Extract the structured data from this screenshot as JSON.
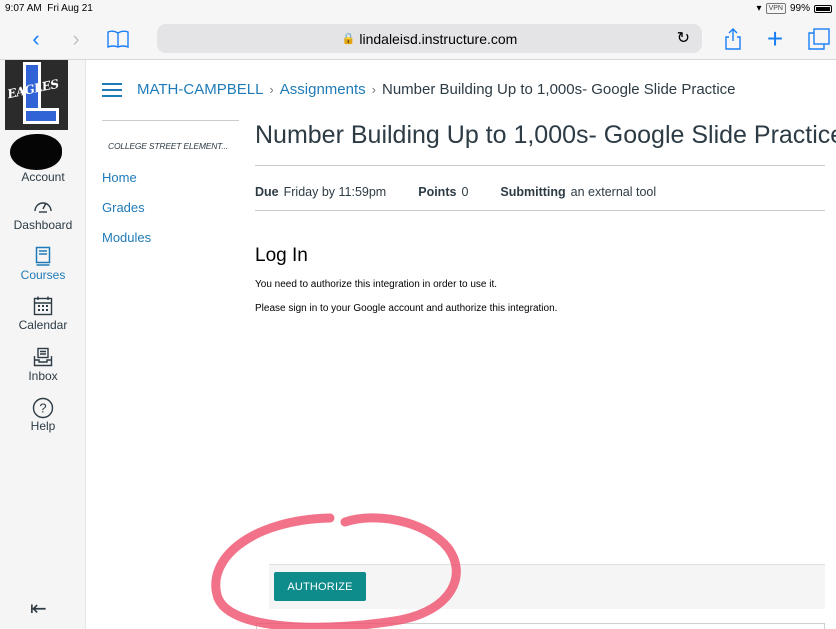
{
  "status_bar": {
    "time": "9:07 AM",
    "date": "Fri Aug 21",
    "vpn": "VPN",
    "battery": "99%",
    "battery_level": 0.99
  },
  "browser": {
    "url": "lindaleisd.instructure.com",
    "back_icon": "chevron-left-icon",
    "forward_icon": "chevron-right-icon",
    "bookmarks_icon": "book-icon",
    "reload_icon": "reload-icon",
    "share_icon": "share-icon",
    "new_tab_icon": "plus-icon",
    "tabs_icon": "tabs-icon"
  },
  "global_nav": {
    "logo_text": "EAGLES",
    "items": [
      {
        "label": "Account",
        "icon": "avatar-icon"
      },
      {
        "label": "Dashboard",
        "icon": "dashboard-icon"
      },
      {
        "label": "Courses",
        "icon": "book-icon",
        "active": true
      },
      {
        "label": "Calendar",
        "icon": "calendar-icon"
      },
      {
        "label": "Inbox",
        "icon": "inbox-icon"
      },
      {
        "label": "Help",
        "icon": "help-icon"
      }
    ]
  },
  "breadcrumb": [
    "MATH-CAMPBELL",
    "Assignments",
    "Number Building Up to 1,000s- Google Slide Practice"
  ],
  "course_nav": {
    "title": "COLLEGE STREET ELEMENT...",
    "items": [
      "Home",
      "Grades",
      "Modules"
    ]
  },
  "assignment": {
    "title": "Number Building Up to 1,000s- Google Slide Practice",
    "due_label": "Due",
    "due_value": "Friday by 11:59pm",
    "points_label": "Points",
    "points_value": "0",
    "submitting_label": "Submitting",
    "submitting_value": "an external tool"
  },
  "login": {
    "heading": "Log In",
    "line1": "You need to authorize this integration in order to use it.",
    "line2": "Please sign in to your Google account and authorize this integration.",
    "button": "AUTHORIZE"
  },
  "colors": {
    "link": "#1f7bb8",
    "button": "#0e8b8b",
    "annotation": "#ee4f6c"
  }
}
